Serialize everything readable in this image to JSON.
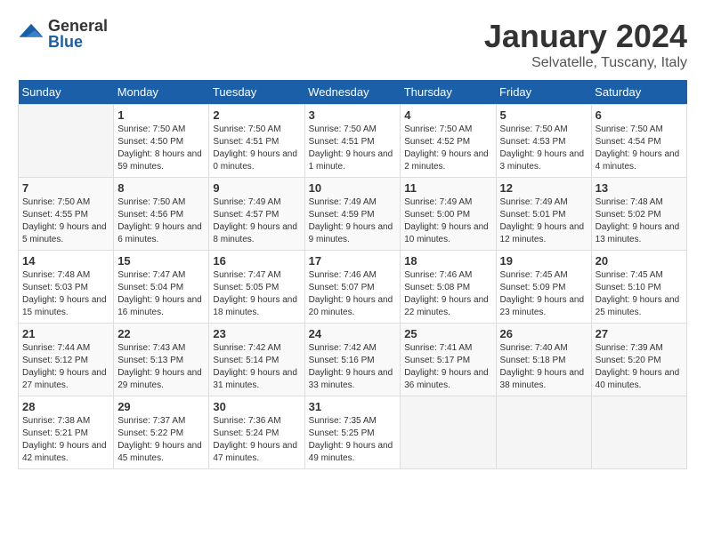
{
  "header": {
    "logo_general": "General",
    "logo_blue": "Blue",
    "month_title": "January 2024",
    "location": "Selvatelle, Tuscany, Italy"
  },
  "days_of_week": [
    "Sunday",
    "Monday",
    "Tuesday",
    "Wednesday",
    "Thursday",
    "Friday",
    "Saturday"
  ],
  "weeks": [
    [
      {
        "day": "",
        "sunrise": "",
        "sunset": "",
        "daylight": ""
      },
      {
        "day": "1",
        "sunrise": "Sunrise: 7:50 AM",
        "sunset": "Sunset: 4:50 PM",
        "daylight": "Daylight: 8 hours and 59 minutes."
      },
      {
        "day": "2",
        "sunrise": "Sunrise: 7:50 AM",
        "sunset": "Sunset: 4:51 PM",
        "daylight": "Daylight: 9 hours and 0 minutes."
      },
      {
        "day": "3",
        "sunrise": "Sunrise: 7:50 AM",
        "sunset": "Sunset: 4:51 PM",
        "daylight": "Daylight: 9 hours and 1 minute."
      },
      {
        "day": "4",
        "sunrise": "Sunrise: 7:50 AM",
        "sunset": "Sunset: 4:52 PM",
        "daylight": "Daylight: 9 hours and 2 minutes."
      },
      {
        "day": "5",
        "sunrise": "Sunrise: 7:50 AM",
        "sunset": "Sunset: 4:53 PM",
        "daylight": "Daylight: 9 hours and 3 minutes."
      },
      {
        "day": "6",
        "sunrise": "Sunrise: 7:50 AM",
        "sunset": "Sunset: 4:54 PM",
        "daylight": "Daylight: 9 hours and 4 minutes."
      }
    ],
    [
      {
        "day": "7",
        "sunrise": "Sunrise: 7:50 AM",
        "sunset": "Sunset: 4:55 PM",
        "daylight": "Daylight: 9 hours and 5 minutes."
      },
      {
        "day": "8",
        "sunrise": "Sunrise: 7:50 AM",
        "sunset": "Sunset: 4:56 PM",
        "daylight": "Daylight: 9 hours and 6 minutes."
      },
      {
        "day": "9",
        "sunrise": "Sunrise: 7:49 AM",
        "sunset": "Sunset: 4:57 PM",
        "daylight": "Daylight: 9 hours and 8 minutes."
      },
      {
        "day": "10",
        "sunrise": "Sunrise: 7:49 AM",
        "sunset": "Sunset: 4:59 PM",
        "daylight": "Daylight: 9 hours and 9 minutes."
      },
      {
        "day": "11",
        "sunrise": "Sunrise: 7:49 AM",
        "sunset": "Sunset: 5:00 PM",
        "daylight": "Daylight: 9 hours and 10 minutes."
      },
      {
        "day": "12",
        "sunrise": "Sunrise: 7:49 AM",
        "sunset": "Sunset: 5:01 PM",
        "daylight": "Daylight: 9 hours and 12 minutes."
      },
      {
        "day": "13",
        "sunrise": "Sunrise: 7:48 AM",
        "sunset": "Sunset: 5:02 PM",
        "daylight": "Daylight: 9 hours and 13 minutes."
      }
    ],
    [
      {
        "day": "14",
        "sunrise": "Sunrise: 7:48 AM",
        "sunset": "Sunset: 5:03 PM",
        "daylight": "Daylight: 9 hours and 15 minutes."
      },
      {
        "day": "15",
        "sunrise": "Sunrise: 7:47 AM",
        "sunset": "Sunset: 5:04 PM",
        "daylight": "Daylight: 9 hours and 16 minutes."
      },
      {
        "day": "16",
        "sunrise": "Sunrise: 7:47 AM",
        "sunset": "Sunset: 5:05 PM",
        "daylight": "Daylight: 9 hours and 18 minutes."
      },
      {
        "day": "17",
        "sunrise": "Sunrise: 7:46 AM",
        "sunset": "Sunset: 5:07 PM",
        "daylight": "Daylight: 9 hours and 20 minutes."
      },
      {
        "day": "18",
        "sunrise": "Sunrise: 7:46 AM",
        "sunset": "Sunset: 5:08 PM",
        "daylight": "Daylight: 9 hours and 22 minutes."
      },
      {
        "day": "19",
        "sunrise": "Sunrise: 7:45 AM",
        "sunset": "Sunset: 5:09 PM",
        "daylight": "Daylight: 9 hours and 23 minutes."
      },
      {
        "day": "20",
        "sunrise": "Sunrise: 7:45 AM",
        "sunset": "Sunset: 5:10 PM",
        "daylight": "Daylight: 9 hours and 25 minutes."
      }
    ],
    [
      {
        "day": "21",
        "sunrise": "Sunrise: 7:44 AM",
        "sunset": "Sunset: 5:12 PM",
        "daylight": "Daylight: 9 hours and 27 minutes."
      },
      {
        "day": "22",
        "sunrise": "Sunrise: 7:43 AM",
        "sunset": "Sunset: 5:13 PM",
        "daylight": "Daylight: 9 hours and 29 minutes."
      },
      {
        "day": "23",
        "sunrise": "Sunrise: 7:42 AM",
        "sunset": "Sunset: 5:14 PM",
        "daylight": "Daylight: 9 hours and 31 minutes."
      },
      {
        "day": "24",
        "sunrise": "Sunrise: 7:42 AM",
        "sunset": "Sunset: 5:16 PM",
        "daylight": "Daylight: 9 hours and 33 minutes."
      },
      {
        "day": "25",
        "sunrise": "Sunrise: 7:41 AM",
        "sunset": "Sunset: 5:17 PM",
        "daylight": "Daylight: 9 hours and 36 minutes."
      },
      {
        "day": "26",
        "sunrise": "Sunrise: 7:40 AM",
        "sunset": "Sunset: 5:18 PM",
        "daylight": "Daylight: 9 hours and 38 minutes."
      },
      {
        "day": "27",
        "sunrise": "Sunrise: 7:39 AM",
        "sunset": "Sunset: 5:20 PM",
        "daylight": "Daylight: 9 hours and 40 minutes."
      }
    ],
    [
      {
        "day": "28",
        "sunrise": "Sunrise: 7:38 AM",
        "sunset": "Sunset: 5:21 PM",
        "daylight": "Daylight: 9 hours and 42 minutes."
      },
      {
        "day": "29",
        "sunrise": "Sunrise: 7:37 AM",
        "sunset": "Sunset: 5:22 PM",
        "daylight": "Daylight: 9 hours and 45 minutes."
      },
      {
        "day": "30",
        "sunrise": "Sunrise: 7:36 AM",
        "sunset": "Sunset: 5:24 PM",
        "daylight": "Daylight: 9 hours and 47 minutes."
      },
      {
        "day": "31",
        "sunrise": "Sunrise: 7:35 AM",
        "sunset": "Sunset: 5:25 PM",
        "daylight": "Daylight: 9 hours and 49 minutes."
      },
      {
        "day": "",
        "sunrise": "",
        "sunset": "",
        "daylight": ""
      },
      {
        "day": "",
        "sunrise": "",
        "sunset": "",
        "daylight": ""
      },
      {
        "day": "",
        "sunrise": "",
        "sunset": "",
        "daylight": ""
      }
    ]
  ]
}
